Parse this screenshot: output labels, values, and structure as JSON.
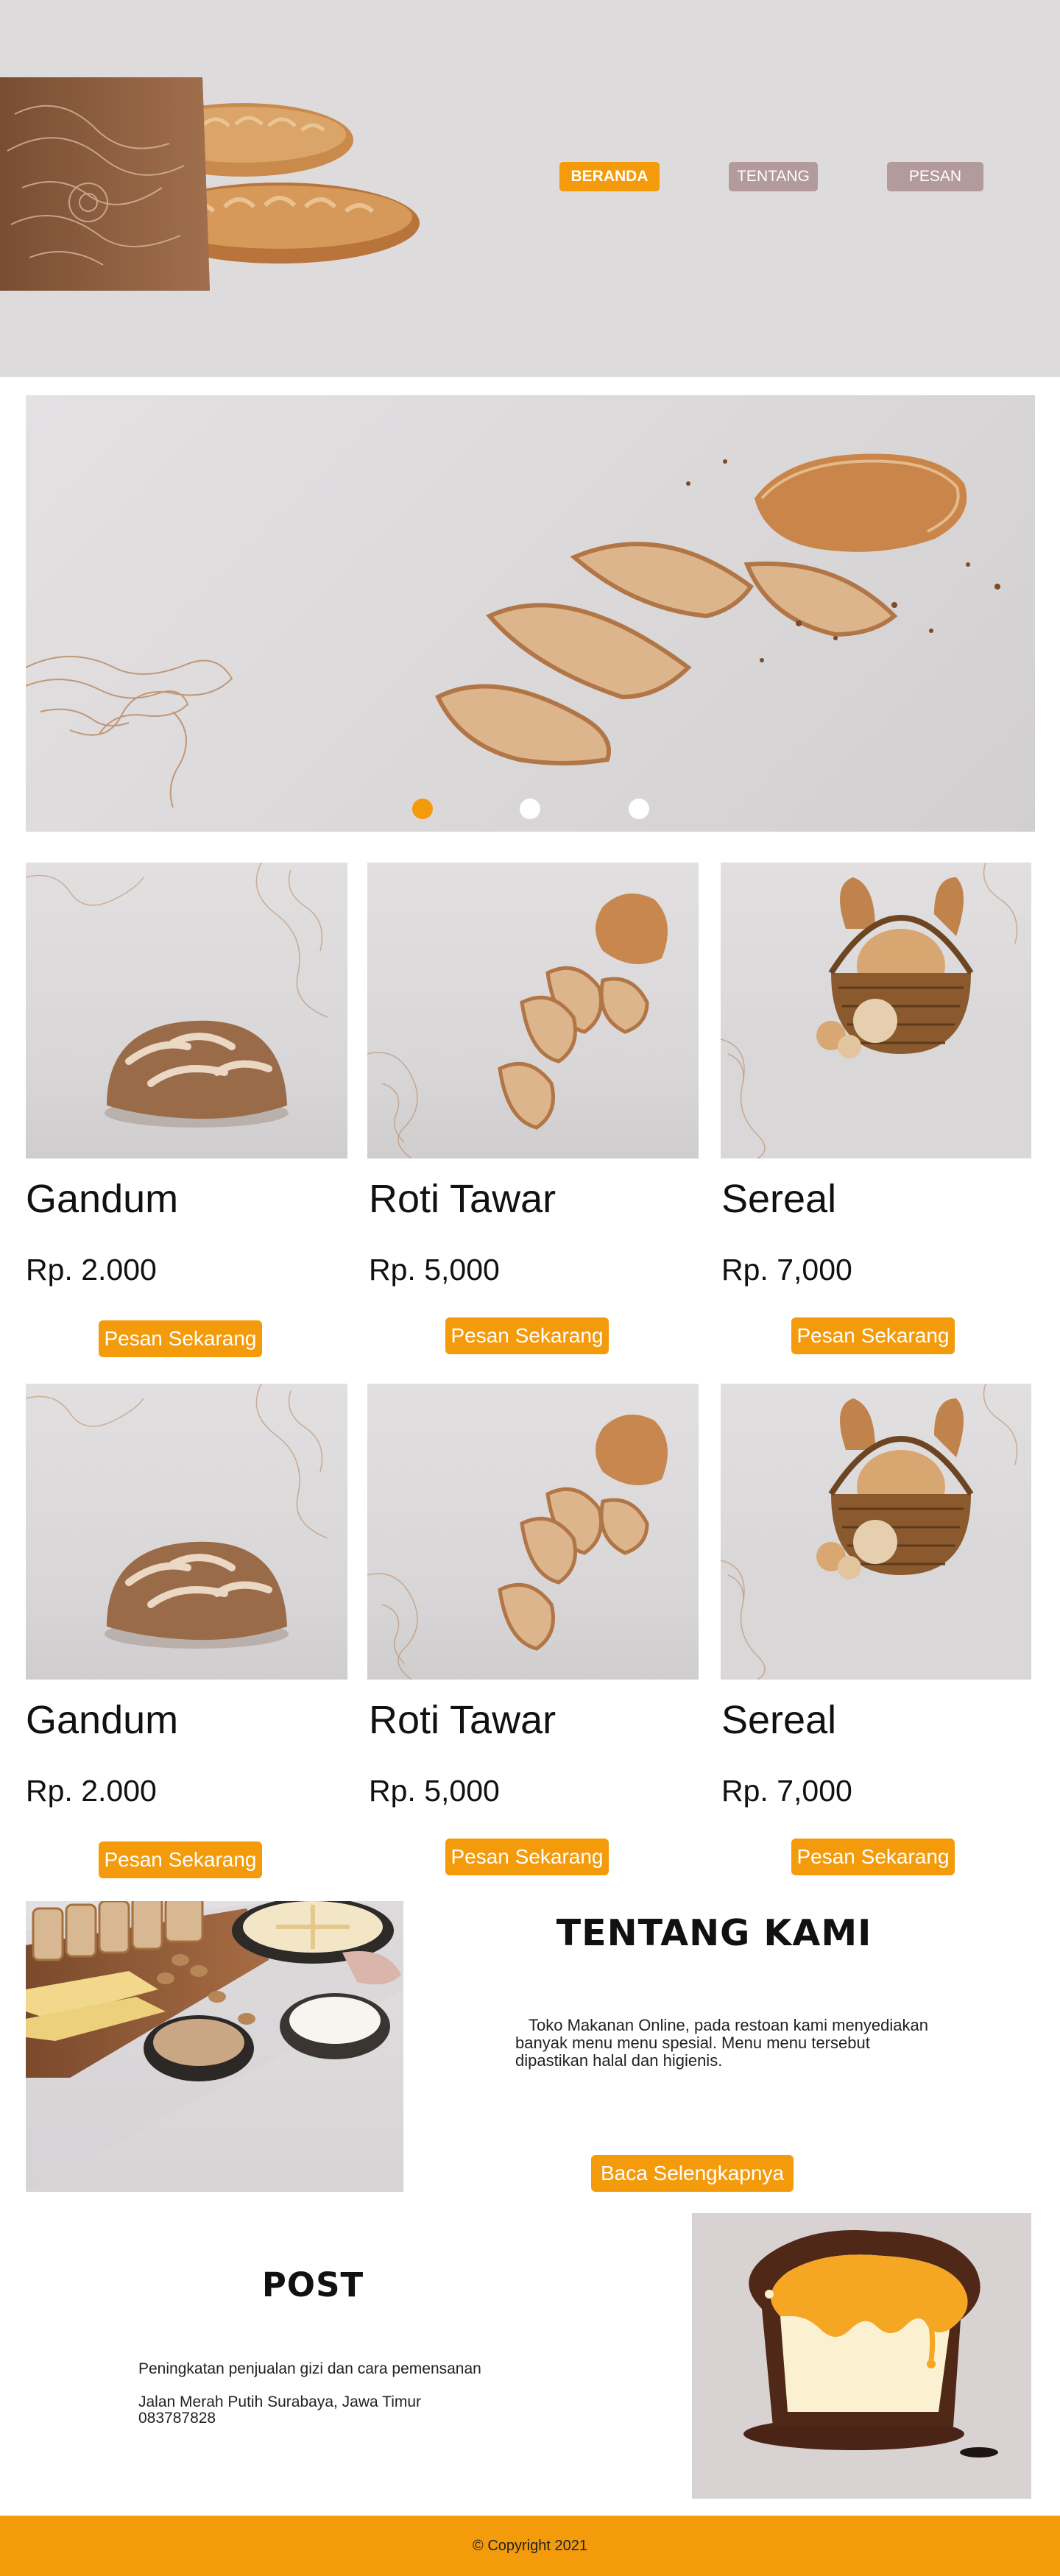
{
  "nav": {
    "items": [
      {
        "label": "BERANDA",
        "color": "#f49b0c",
        "active": true
      },
      {
        "label": "TENTANG",
        "color": "#b39a9d",
        "active": false
      },
      {
        "label": "PESAN",
        "color": "#b39a9d",
        "active": false
      }
    ]
  },
  "hero": {
    "slide_dots": [
      {
        "active": true,
        "color": "#f49b0c"
      },
      {
        "active": false,
        "color": "#ffffff"
      },
      {
        "active": false,
        "color": "#ffffff"
      }
    ]
  },
  "products": {
    "row1": [
      {
        "name": "Gandum",
        "price": "Rp. 2.000",
        "button": "Pesan Sekarang"
      },
      {
        "name": "Roti Tawar",
        "price": "Rp. 5,000",
        "button": "Pesan Sekarang"
      },
      {
        "name": "Sereal",
        "price": "Rp. 7,000",
        "button": "Pesan Sekarang"
      }
    ],
    "row2": [
      {
        "name": "Gandum",
        "price": "Rp. 2.000",
        "button": "Pesan Sekarang"
      },
      {
        "name": "Roti Tawar",
        "price": "Rp. 5,000",
        "button": "Pesan Sekarang"
      },
      {
        "name": "Sereal",
        "price": "Rp. 7,000",
        "button": "Pesan Sekarang"
      }
    ]
  },
  "about": {
    "title": "TENTANG KAMI",
    "text_lines": [
      "Toko Makanan Online, pada restoan kami menyediakan",
      "banyak menu menu spesial. Menu menu tersebut",
      "dipastikan halal dan higienis."
    ],
    "button": "Baca Selengkapnya"
  },
  "post": {
    "title": "POST",
    "line1": "Peningkatan penjualan gizi dan cara pemensanan",
    "line2": "Jalan Merah Putih Surabaya, Jawa Timur",
    "line3": "083787828"
  },
  "footer": {
    "copyright": "© Copyright 2021"
  },
  "colors": {
    "accent": "#f49b0c",
    "nav_inactive": "#b39a9d",
    "header_bg": "#dedbdc"
  }
}
